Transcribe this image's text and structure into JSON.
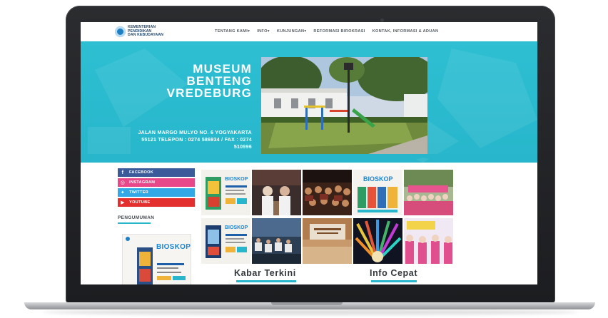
{
  "site": {
    "logo_lines": [
      "KEMENTERIAN",
      "PENDIDIKAN",
      "DAN KEBUDAYAAN"
    ],
    "nav": [
      {
        "label": "TENTANG KAMI",
        "has_dropdown": true
      },
      {
        "label": "INFO",
        "has_dropdown": true
      },
      {
        "label": "KUNJUNGAN",
        "has_dropdown": true
      },
      {
        "label": "REFORMASI BIROKRASI",
        "has_dropdown": false
      },
      {
        "label": "KONTAK, INFORMASI & ADUAN",
        "has_dropdown": false
      }
    ]
  },
  "hero": {
    "title_lines": [
      "MUSEUM",
      "BENTENG",
      "VREDEBURG"
    ],
    "address": "JALAN MARGO MULYO NO. 6 YOGYAKARTA 55121 TELEPON : 0274 586934 / FAX : 0274 510996"
  },
  "social": [
    {
      "label": "FACEBOOK",
      "icon": "facebook-icon",
      "glyph": "f",
      "color": "#3a5a99"
    },
    {
      "label": "INSTAGRAM",
      "icon": "instagram-icon",
      "glyph": "◎",
      "color": "#e8488a"
    },
    {
      "label": "TWITTER",
      "icon": "twitter-icon",
      "glyph": "✦",
      "color": "#32a9e6"
    },
    {
      "label": "YOUTUBE",
      "icon": "youtube-icon",
      "glyph": "▶",
      "color": "#e3302f"
    }
  ],
  "sidebar": {
    "announcement_heading": "PENGUMUMAN",
    "poster_word": "BIOSKOP"
  },
  "gallery_posters": {
    "word": "BIOSKOP"
  },
  "sections": {
    "news": "Kabar Terkini",
    "info": "Info Cepat"
  },
  "colors": {
    "accent": "#27b6cb",
    "hero_bg": "#2ebfd3",
    "laptop_body": "#232427"
  }
}
